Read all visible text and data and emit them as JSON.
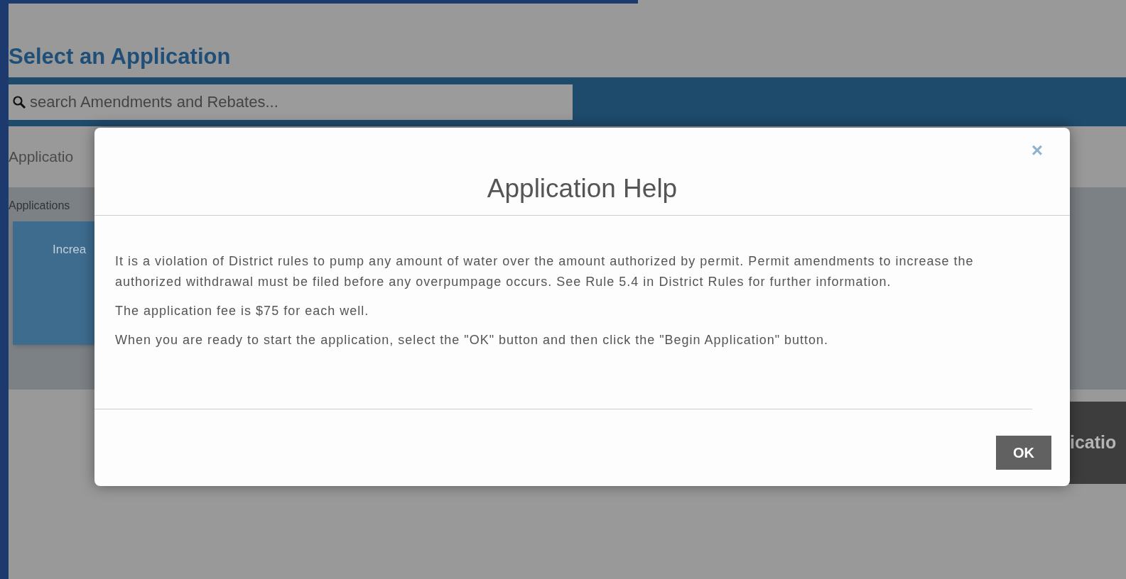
{
  "page": {
    "heading": "Select an Application",
    "search": {
      "placeholder": "search Amendments and Rebates..."
    },
    "section_label": "Applicatio",
    "panel_label": "Applications",
    "card": {
      "label": "Increa"
    },
    "begin_button": {
      "label": "icatio"
    }
  },
  "dialog": {
    "close": "×",
    "title": "Application Help",
    "paragraphs": [
      "It is a violation of District rules to pump any amount of water over the amount authorized by permit. Permit amendments to increase the authorized withdrawal must be filed before any overpumpage occurs. See Rule 5.4 in District Rules for further information.",
      "The application fee is $75 for each well.",
      "When you are ready to start the application, select the \"OK\" button and then click the \"Begin Application\" button."
    ],
    "ok": "OK"
  }
}
